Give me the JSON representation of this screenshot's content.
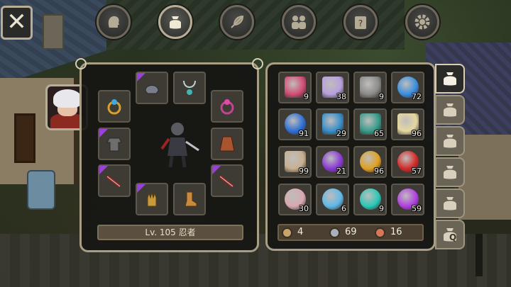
{
  "top_tabs": [
    {
      "name": "character",
      "icon": "head-silhouette-icon",
      "active": false
    },
    {
      "name": "bag",
      "icon": "bag-icon",
      "active": true
    },
    {
      "name": "skills",
      "icon": "feather-icon",
      "active": false
    },
    {
      "name": "party",
      "icon": "party-icon",
      "active": false
    },
    {
      "name": "quests",
      "icon": "scroll-icon",
      "active": false
    },
    {
      "name": "settings",
      "icon": "gear-icon",
      "active": false
    }
  ],
  "close_label": "✕",
  "equipment": {
    "level_text": "Lv. 105 忍者",
    "slots": [
      {
        "name": "helmet",
        "icon": "helmet-icon",
        "rare": true,
        "color": "#7a7e8c"
      },
      {
        "name": "necklace",
        "icon": "necklace-icon",
        "rare": false,
        "color": "#bcd3d3"
      },
      {
        "name": "ring-left",
        "icon": "ring-icon",
        "rare": false,
        "color": "#d4a030"
      },
      {
        "name": "ring-right",
        "icon": "ring-icon",
        "rare": false,
        "color": "#c0468e"
      },
      {
        "name": "armor",
        "icon": "armor-icon",
        "rare": true,
        "color": "#6e6e6e"
      },
      {
        "name": "cloak",
        "icon": "cloak-icon",
        "rare": false,
        "color": "#a8542e"
      },
      {
        "name": "weapon-left",
        "icon": "sword-icon",
        "rare": true,
        "color": "#9a2424"
      },
      {
        "name": "weapon-right",
        "icon": "sword-icon",
        "rare": true,
        "color": "#9a2424"
      },
      {
        "name": "gloves",
        "icon": "gloves-icon",
        "rare": true,
        "color": "#c89a3c"
      },
      {
        "name": "boots",
        "icon": "boots-icon",
        "rare": false,
        "color": "#c88a3c"
      }
    ]
  },
  "inventory": {
    "items": [
      {
        "icon": "flower-icon",
        "qty": "9",
        "color": "#d24f76"
      },
      {
        "icon": "crystal-scroll-icon",
        "qty": "38",
        "color": "#b8a0dc"
      },
      {
        "icon": "anvil-icon",
        "qty": "9",
        "color": "#8c8c8c"
      },
      {
        "icon": "blue-swirl-icon",
        "qty": "72",
        "color": "#3a8ee0"
      },
      {
        "icon": "blue-ore-icon",
        "qty": "91",
        "color": "#2f6fd4"
      },
      {
        "icon": "blue-branch-icon",
        "qty": "29",
        "color": "#3a8ec8"
      },
      {
        "icon": "teal-root-icon",
        "qty": "65",
        "color": "#3a9c8c"
      },
      {
        "icon": "map-scroll-icon",
        "qty": "96",
        "color": "#e6d8a0"
      },
      {
        "icon": "claw-icon",
        "qty": "99",
        "color": "#c8b090"
      },
      {
        "icon": "purple-potion-icon",
        "qty": "21",
        "color": "#8a3ad4"
      },
      {
        "icon": "gold-orb-icon",
        "qty": "96",
        "color": "#e0a020"
      },
      {
        "icon": "red-potion-icon",
        "qty": "57",
        "color": "#d42a2a"
      },
      {
        "icon": "pink-rock-icon",
        "qty": "30",
        "color": "#d8a8b0"
      },
      {
        "icon": "blue-pearls-icon",
        "qty": "6",
        "color": "#60b8e8"
      },
      {
        "icon": "teal-potion-icon",
        "qty": "9",
        "color": "#2ac8b8"
      },
      {
        "icon": "violet-potion-icon",
        "qty": "59",
        "color": "#b040e0"
      }
    ],
    "currency": [
      {
        "name": "gold",
        "icon": "coin-gold-icon",
        "value": "4",
        "color": "#c8a46a"
      },
      {
        "name": "silver",
        "icon": "coin-silver-icon",
        "value": "69",
        "color": "#a8b0b8"
      },
      {
        "name": "copper",
        "icon": "coin-copper-icon",
        "value": "16",
        "color": "#d4775a"
      }
    ]
  },
  "bag_tabs": [
    {
      "name": "bag-1",
      "active": true
    },
    {
      "name": "bag-2",
      "active": false
    },
    {
      "name": "bag-3",
      "active": false
    },
    {
      "name": "bag-4",
      "active": false
    },
    {
      "name": "bag-5",
      "active": false
    },
    {
      "name": "bag-quest",
      "active": false,
      "label": "Q"
    }
  ]
}
